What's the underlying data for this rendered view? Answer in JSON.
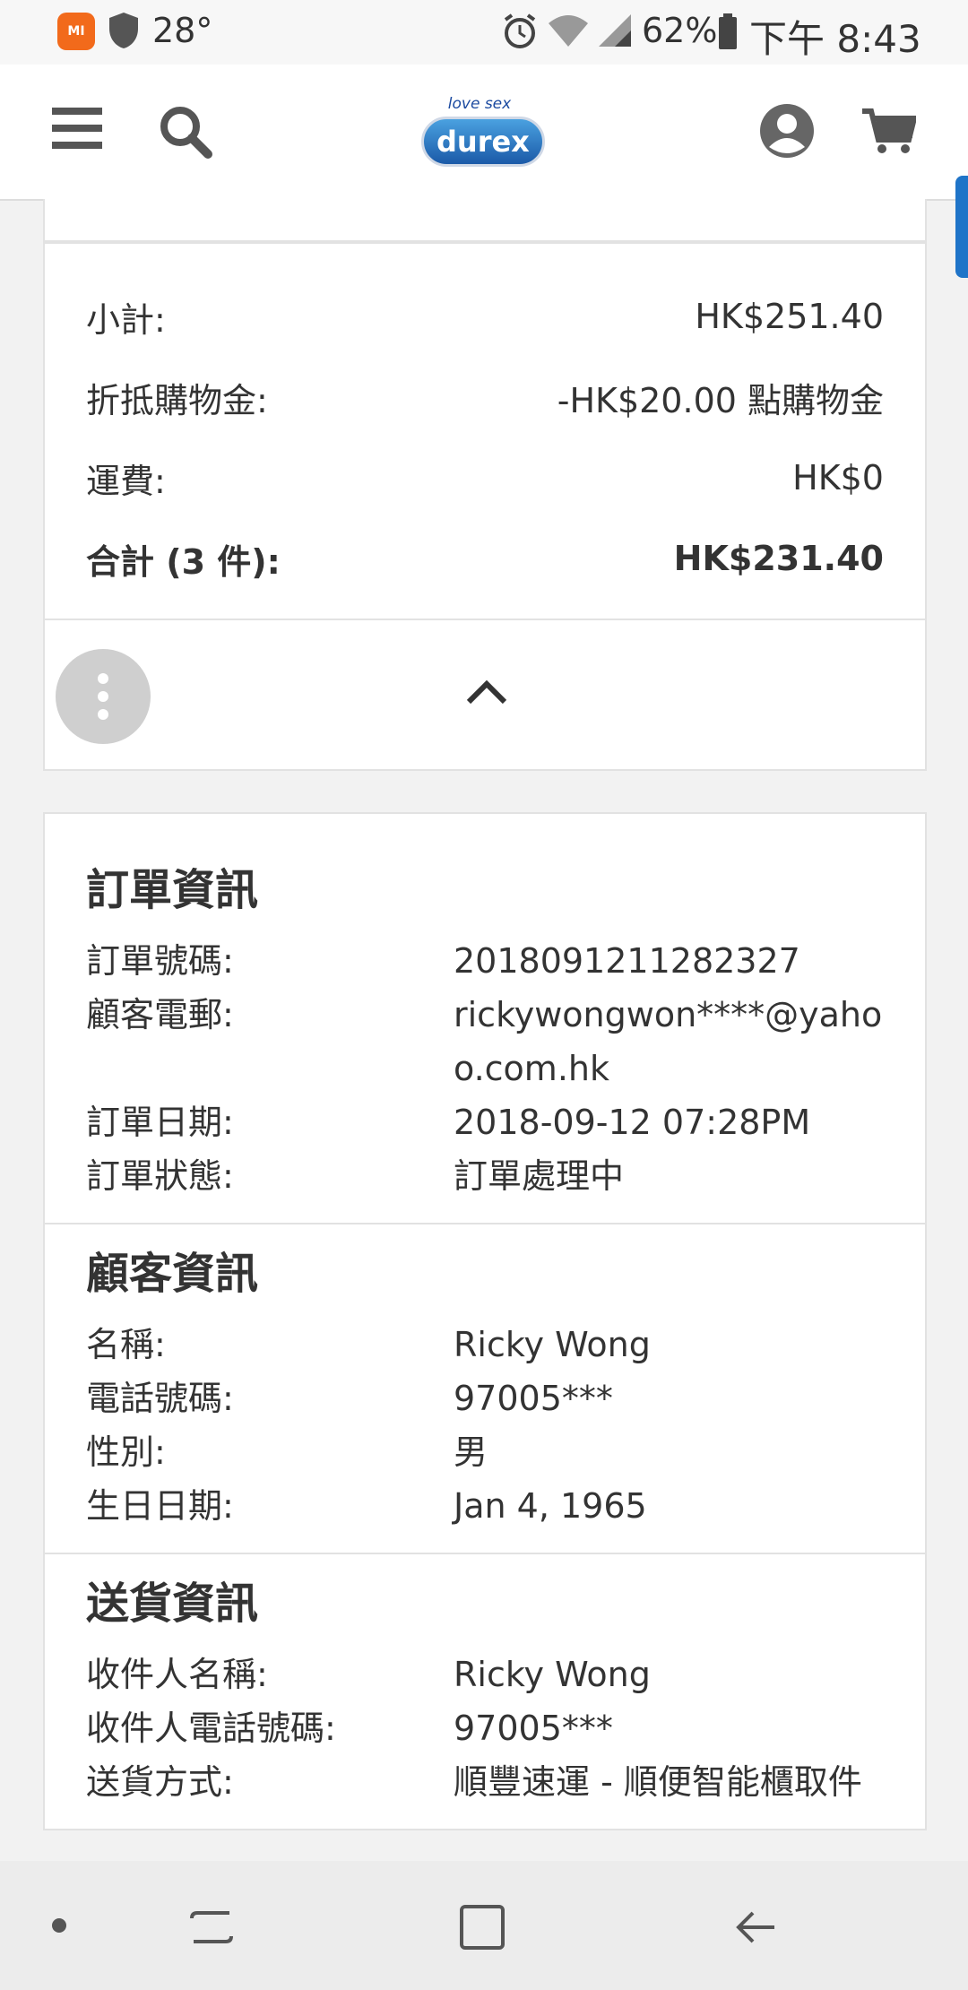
{
  "status_bar": {
    "temperature": "28°",
    "battery": "62%",
    "time": "下午 8:43",
    "mi_label": "MI"
  },
  "header": {
    "logo_tagline": "love sex",
    "logo_brand": "durex"
  },
  "totals": {
    "rows": [
      {
        "label": "小計:",
        "value": "HK$251.40"
      },
      {
        "label": "折抵購物金:",
        "value": "-HK$20.00 點購物金"
      },
      {
        "label": "運費:",
        "value": "HK$0"
      },
      {
        "label": "合計 (3 件):",
        "value": "HK$231.40"
      }
    ]
  },
  "order_info": {
    "title": "訂單資訊",
    "rows": [
      {
        "label": "訂單號碼:",
        "value": "2018091211282327"
      },
      {
        "label": "顧客電郵:",
        "value": "rickywongwon****@yahoo.com.hk"
      },
      {
        "label": "訂單日期:",
        "value": "2018-09-12 07:28PM"
      },
      {
        "label": "訂單狀態:",
        "value": "訂單處理中"
      }
    ]
  },
  "customer_info": {
    "title": "顧客資訊",
    "rows": [
      {
        "label": "名稱:",
        "value": "Ricky Wong"
      },
      {
        "label": "電話號碼:",
        "value": "97005***"
      },
      {
        "label": "性別:",
        "value": "男"
      },
      {
        "label": "生日日期:",
        "value": "Jan 4, 1965"
      }
    ]
  },
  "delivery_info": {
    "title": "送貨資訊",
    "rows": [
      {
        "label": "收件人名稱:",
        "value": "Ricky Wong"
      },
      {
        "label": "收件人電話號碼:",
        "value": "97005***"
      },
      {
        "label": "送貨方式:",
        "value": "順豐速運 - 順便智能櫃取件"
      }
    ]
  },
  "colors": {
    "brand_blue": "#1f74c8",
    "status_orange": "#f26a1b"
  }
}
